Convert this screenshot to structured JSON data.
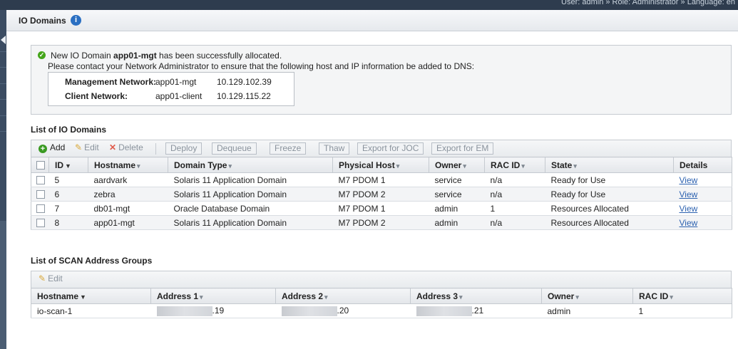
{
  "topbar": {
    "user_text": "User: admin » Role: Administrator » Language: en"
  },
  "page": {
    "title": "IO Domains",
    "info_icon": "i"
  },
  "message": {
    "prefix": "New IO Domain ",
    "domain": "app01-mgt",
    "suffix": " has been successfully allocated.",
    "line2": "Please contact your Network Administrator to ensure that the following host and IP information be added to DNS:",
    "networks": [
      {
        "label": "Management Network:",
        "host": "app01-mgt",
        "ip": "10.129.102.39"
      },
      {
        "label": "Client Network:",
        "host": "app01-client",
        "ip": "10.129.115.22"
      }
    ]
  },
  "io_domains": {
    "section_title": "List of IO Domains",
    "toolbar": {
      "add": "Add",
      "edit": "Edit",
      "delete": "Delete",
      "deploy": "Deploy",
      "dequeue": "Dequeue",
      "freeze": "Freeze",
      "thaw": "Thaw",
      "export_joc": "Export for JOC",
      "export_em": "Export for EM"
    },
    "columns": [
      "ID",
      "Hostname",
      "Domain Type",
      "Physical Host",
      "Owner",
      "RAC ID",
      "State",
      "Details"
    ],
    "rows": [
      {
        "id": "5",
        "hostname": "aardvark",
        "domain_type": "Solaris 11 Application Domain",
        "physical_host": "M7 PDOM 1",
        "owner": "service",
        "rac_id": "n/a",
        "state": "Ready for Use",
        "details": "View"
      },
      {
        "id": "6",
        "hostname": "zebra",
        "domain_type": "Solaris 11 Application Domain",
        "physical_host": "M7 PDOM 2",
        "owner": "service",
        "rac_id": "n/a",
        "state": "Ready for Use",
        "details": "View"
      },
      {
        "id": "7",
        "hostname": "db01-mgt",
        "domain_type": "Oracle Database Domain",
        "physical_host": "M7 PDOM 1",
        "owner": "admin",
        "rac_id": "1",
        "state": "Resources Allocated",
        "details": "View"
      },
      {
        "id": "8",
        "hostname": "app01-mgt",
        "domain_type": "Solaris 11 Application Domain",
        "physical_host": "M7 PDOM 2",
        "owner": "admin",
        "rac_id": "n/a",
        "state": "Resources Allocated",
        "details": "View"
      }
    ]
  },
  "scan_groups": {
    "section_title": "List of SCAN Address Groups",
    "toolbar": {
      "edit": "Edit"
    },
    "columns": [
      "Hostname",
      "Address 1",
      "Address 2",
      "Address 3",
      "Owner",
      "RAC ID"
    ],
    "rows": [
      {
        "hostname": "io-scan-1",
        "address1": ".19",
        "address2": ".20",
        "address3": ".21",
        "owner": "admin",
        "rac_id": "1"
      }
    ]
  },
  "colors": {
    "header_dark": "#2e3c4e",
    "link": "#2d62b0",
    "success": "#44a51a",
    "info": "#2a6fc2"
  },
  "icons": [
    "info-icon",
    "success-check-icon",
    "add-icon",
    "edit-pencil-icon",
    "delete-x-icon",
    "sort-arrow-icon",
    "checkbox"
  ]
}
